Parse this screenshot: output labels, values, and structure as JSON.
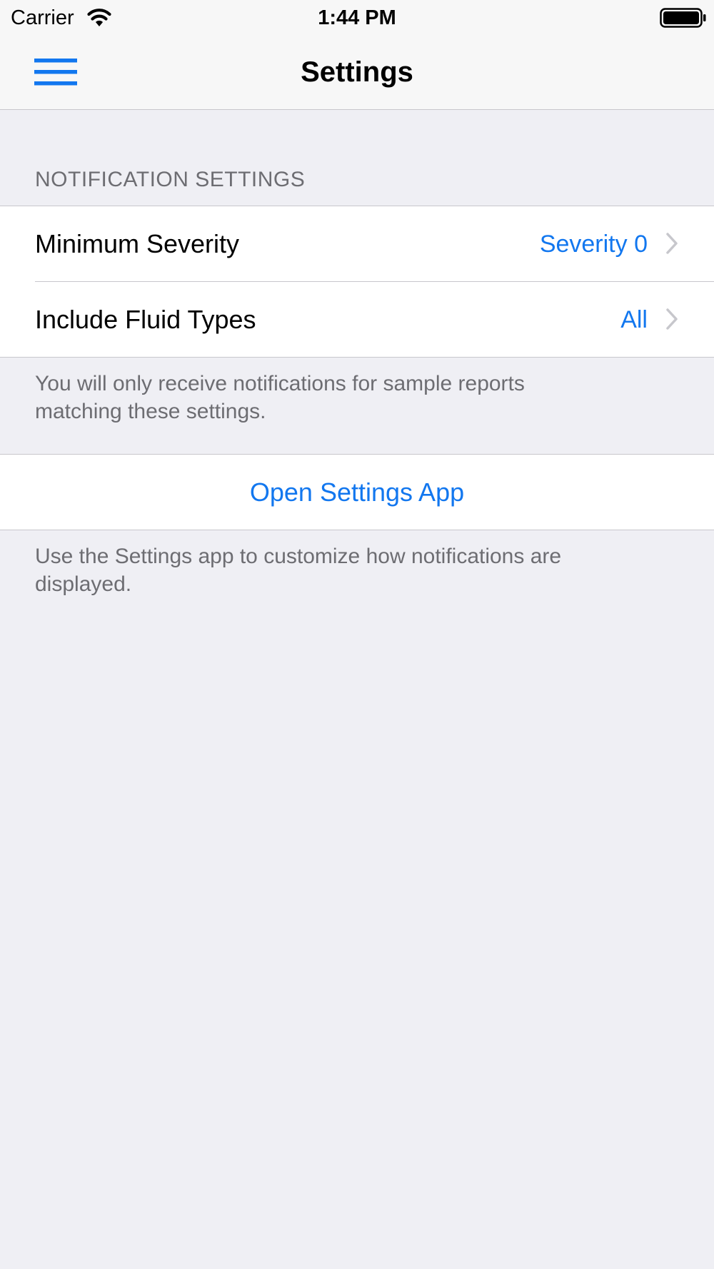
{
  "status_bar": {
    "carrier": "Carrier",
    "time": "1:44 PM",
    "wifi_icon": "wifi-icon",
    "battery_icon": "battery-full-icon"
  },
  "nav": {
    "title": "Settings",
    "menu_icon": "hamburger-menu-icon"
  },
  "colors": {
    "accent": "#1277ef",
    "background": "#efeff4",
    "secondary_text": "#6d6d72",
    "separator": "#c8c7cc"
  },
  "notification_section": {
    "header": "NOTIFICATION SETTINGS",
    "rows": [
      {
        "label": "Minimum Severity",
        "value": "Severity 0"
      },
      {
        "label": "Include Fluid Types",
        "value": "All"
      }
    ],
    "footer": "You will only receive notifications for sample reports matching these settings."
  },
  "settings_app_section": {
    "button_label": "Open Settings App",
    "footer": "Use the Settings app to customize how notifications are displayed."
  }
}
